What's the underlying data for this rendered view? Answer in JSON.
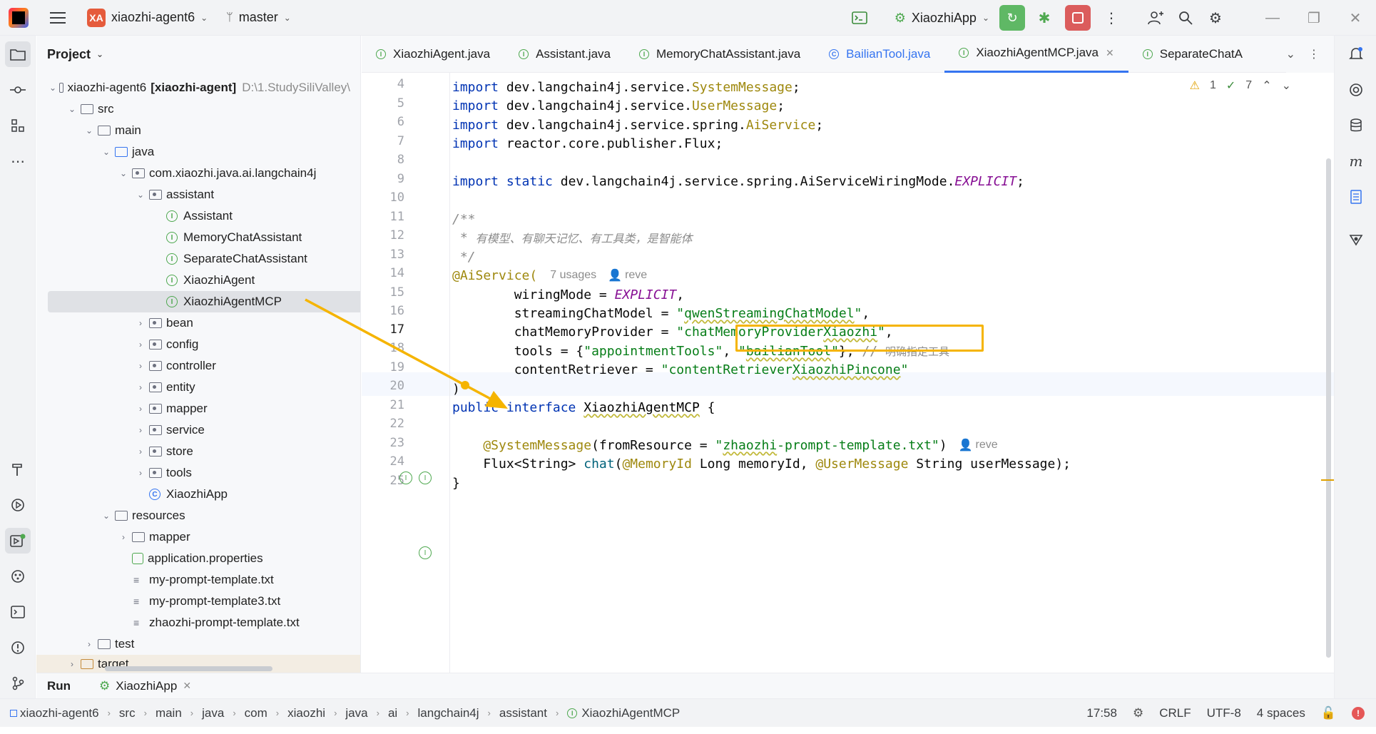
{
  "titlebar": {
    "project_badge": "XA",
    "project_name": "xiaozhi-agent6",
    "branch": "master",
    "run_config": "XiaozhiApp"
  },
  "project_panel": {
    "title": "Project",
    "root_name": "xiaozhi-agent6",
    "root_module": "[xiaozhi-agent]",
    "root_path": "D:\\1.StudySiliValley\\",
    "items": [
      {
        "label": "src"
      },
      {
        "label": "main"
      },
      {
        "label": "java"
      },
      {
        "label": "com.xiaozhi.java.ai.langchain4j"
      },
      {
        "label": "assistant"
      },
      {
        "label": "Assistant"
      },
      {
        "label": "MemoryChatAssistant"
      },
      {
        "label": "SeparateChatAssistant"
      },
      {
        "label": "XiaozhiAgent"
      },
      {
        "label": "XiaozhiAgentMCP"
      },
      {
        "label": "bean"
      },
      {
        "label": "config"
      },
      {
        "label": "controller"
      },
      {
        "label": "entity"
      },
      {
        "label": "mapper"
      },
      {
        "label": "service"
      },
      {
        "label": "store"
      },
      {
        "label": "tools"
      },
      {
        "label": "XiaozhiApp"
      },
      {
        "label": "resources"
      },
      {
        "label": "mapper"
      },
      {
        "label": "application.properties"
      },
      {
        "label": "my-prompt-template.txt"
      },
      {
        "label": "my-prompt-template3.txt"
      },
      {
        "label": "zhaozhi-prompt-template.txt"
      },
      {
        "label": "test"
      },
      {
        "label": "target"
      }
    ]
  },
  "tabs": [
    {
      "label": "XiaozhiAgent.java"
    },
    {
      "label": "Assistant.java"
    },
    {
      "label": "MemoryChatAssistant.java"
    },
    {
      "label": "BailianTool.java"
    },
    {
      "label": "XiaozhiAgentMCP.java"
    },
    {
      "label": "SeparateChatA"
    }
  ],
  "inspections": {
    "warnings": "1",
    "weak_warnings": "7"
  },
  "editor": {
    "line_numbers": [
      "4",
      "5",
      "6",
      "7",
      "8",
      "9",
      "10",
      "11",
      "12",
      "13",
      "14",
      "15",
      "16",
      "17",
      "18",
      "19",
      "20",
      "21",
      "22",
      "23",
      "24",
      "25"
    ],
    "current_line": "17",
    "code": {
      "l4_kw": "import",
      "l4_pkg": " dev.langchain4j.service.",
      "l4_cls": "SystemMessage",
      "l4_end": ";",
      "l5_kw": "import",
      "l5_pkg": " dev.langchain4j.service.",
      "l5_cls": "UserMessage",
      "l5_end": ";",
      "l6_kw": "import",
      "l6_pkg": " dev.langchain4j.service.spring.",
      "l6_cls": "AiService",
      "l6_end": ";",
      "l7_kw": "import",
      "l7_pkg": " reactor.core.publisher.Flux;",
      "l9_kw": "import static",
      "l9_pkg": " dev.langchain4j.service.spring.AiServiceWiringMode.",
      "l9_const": "EXPLICIT",
      "l9_end": ";",
      "l11": "/**",
      "l12_star": " * ",
      "l12_zh": "有模型、有聊天记忆、有工具类，是智能体",
      "l13": " */",
      "l14_ann": "@AiService(",
      "l14_usages": "7 usages",
      "l14_author": "reve",
      "l15_key": "        wiringMode = ",
      "l15_const": "EXPLICIT",
      "l15_end": ",",
      "l16_key": "        streamingChatModel = ",
      "l16_q1": "\"",
      "l16_val": "qwenStreamingChatModel",
      "l16_q2": "\"",
      "l16_end": ",",
      "l17_key": "        chatMemoryProvider = ",
      "l17_v1": "\"chatMemoryProvider",
      "l17_v2": "Xiaozhi",
      "l17_v3": "\"",
      "l17_end": ",",
      "l18_key": "        tools = {",
      "l18_s1": "\"appointmentTools\"",
      "l18_comma": ", ",
      "l18_s2a": "\"",
      "l18_s2b": "bailianTool",
      "l18_s2c": "\"",
      "l18_close": "}, ",
      "l18_cmt": "// ",
      "l18_cmt_zh": "明确指定工具",
      "l19_key": "        contentRetriever = ",
      "l19_v1": "\"contentRetriever",
      "l19_v2": "XiaozhiPincone",
      "l19_v3": "\"",
      "l20": ")",
      "l21_kw": "public interface ",
      "l21_cls": "XiaozhiAgentMCP",
      "l21_end": " {",
      "l23_ann": "    @SystemMessage",
      "l23_a": "(fromResource = ",
      "l23_q1": "\"",
      "l23_val": "zhaozhi",
      "l23_rest": "-prompt-template.txt\"",
      "l23_end": ")",
      "l23_author": "reve",
      "l24_type": "    Flux<String> ",
      "l24_fn": "chat",
      "l24_p1": "(",
      "l24_ann1": "@MemoryId",
      "l24_p2": " Long memoryId, ",
      "l24_ann2": "@UserMessage",
      "l24_p3": " String userMessage);",
      "l25": "}"
    }
  },
  "runbar": {
    "title": "Run",
    "tab": "XiaozhiApp"
  },
  "statusbar": {
    "breadcrumb": [
      "xiaozhi-agent6",
      "src",
      "main",
      "java",
      "com",
      "xiaozhi",
      "java",
      "ai",
      "langchain4j",
      "assistant",
      "XiaozhiAgentMCP"
    ],
    "position": "17:58",
    "line_sep": "CRLF",
    "encoding": "UTF-8",
    "indent": "4 spaces"
  },
  "colors": {
    "accent": "#3574f0",
    "highlight_box": "#f5b400",
    "arrow": "#f5b400"
  }
}
